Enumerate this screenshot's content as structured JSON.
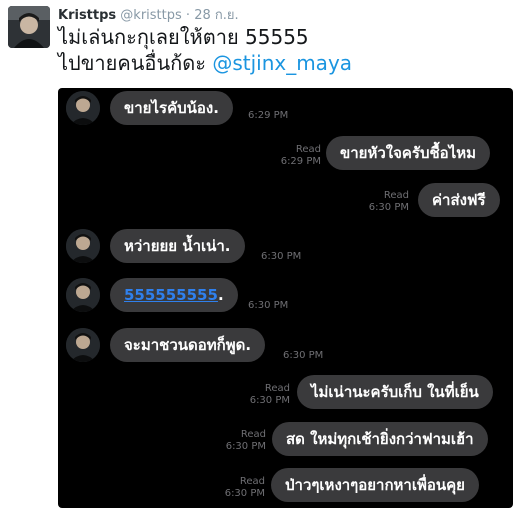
{
  "tweet": {
    "author_name": "Kristtps",
    "author_handle": "@kristtps",
    "separator": "·",
    "date": "28 ก.ย.",
    "text_line1": "ไม่เล่นกะกุเลยให้ตาย 55555",
    "text_line2_prefix": "ไปขายคนอื่นก้ดะ ",
    "mention": "@stjinx_maya"
  },
  "chat": {
    "background": "#000000",
    "bubble_color": "#3a3a3c",
    "read_label": "Read",
    "messages": [
      {
        "text": "ขายไรคับน้อง.",
        "time": "6:29 PM"
      },
      {
        "text": "ขายหัวใจครับชื้อไหม",
        "time": "6:29 PM"
      },
      {
        "text": "ค่าส่งฟรี",
        "time": "6:30 PM"
      },
      {
        "text": "หว่ายยย น้ำเน่า.",
        "time": "6:30 PM"
      },
      {
        "text": "555555555",
        "suffix": ".",
        "time": "6:30 PM"
      },
      {
        "text": "จะมาชวนดอทก็พูด.",
        "time": "6:30 PM"
      },
      {
        "text": "ไม่เน่านะครับเก็บ ในที่เย็น",
        "time": "6:30 PM"
      },
      {
        "text": "สด ใหม่ทุกเช้ายิ่งกว่าฟามเฮ้า",
        "time": "6:30 PM"
      },
      {
        "text": "ป่าวๆเหงาๆอยากหาเพื่อนคุย",
        "time": "6:30 PM"
      }
    ]
  }
}
